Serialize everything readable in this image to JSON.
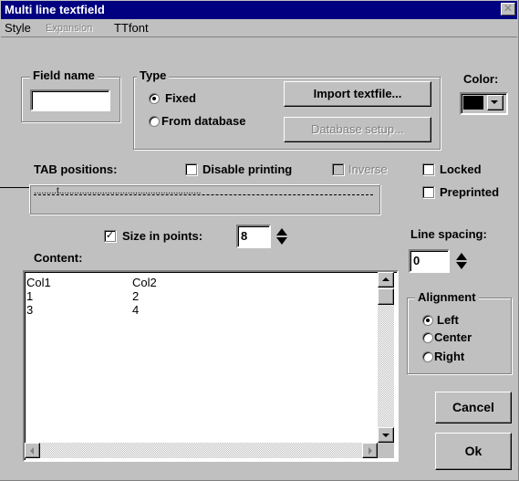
{
  "window": {
    "title": "Multi line textfield",
    "close_label": "✕"
  },
  "menu": {
    "items": [
      {
        "label": "Style",
        "disabled": false
      },
      {
        "label": "Expansion",
        "disabled": true
      },
      {
        "label": "TTfont",
        "disabled": false
      }
    ]
  },
  "field_name": {
    "label": "Field name",
    "value": ""
  },
  "type": {
    "label": "Type",
    "options": [
      {
        "label": "Fixed",
        "selected": true
      },
      {
        "label": "From database",
        "selected": false
      }
    ],
    "import_button": "Import textfile...",
    "database_button": "Database setup..."
  },
  "color": {
    "label": "Color:",
    "value": "#000000"
  },
  "tab_positions": {
    "label": "TAB positions:",
    "ruler": ".........t........................................................"
  },
  "checkboxes": {
    "disable_printing": {
      "label": "Disable printing",
      "checked": false
    },
    "inverse": {
      "label": "Inverse",
      "checked": false,
      "disabled": true
    },
    "locked": {
      "label": "Locked",
      "checked": false
    },
    "preprinted": {
      "label": "Preprinted",
      "checked": false
    },
    "size_in_points": {
      "label": "Size in points:",
      "checked": true,
      "check_glyph": "✓"
    }
  },
  "size": {
    "value": "8"
  },
  "line_spacing": {
    "label": "Line spacing:",
    "value": "0"
  },
  "content": {
    "label": "Content:",
    "rows": [
      {
        "c1": "Col1",
        "c2": "Col2"
      },
      {
        "c1": "1",
        "c2": "2"
      },
      {
        "c1": "3",
        "c2": "4"
      }
    ]
  },
  "alignment": {
    "label": "Alignment",
    "options": [
      {
        "label": "Left",
        "selected": true
      },
      {
        "label": "Center",
        "selected": false
      },
      {
        "label": "Right",
        "selected": false
      }
    ]
  },
  "buttons": {
    "cancel": "Cancel",
    "ok": "Ok"
  }
}
